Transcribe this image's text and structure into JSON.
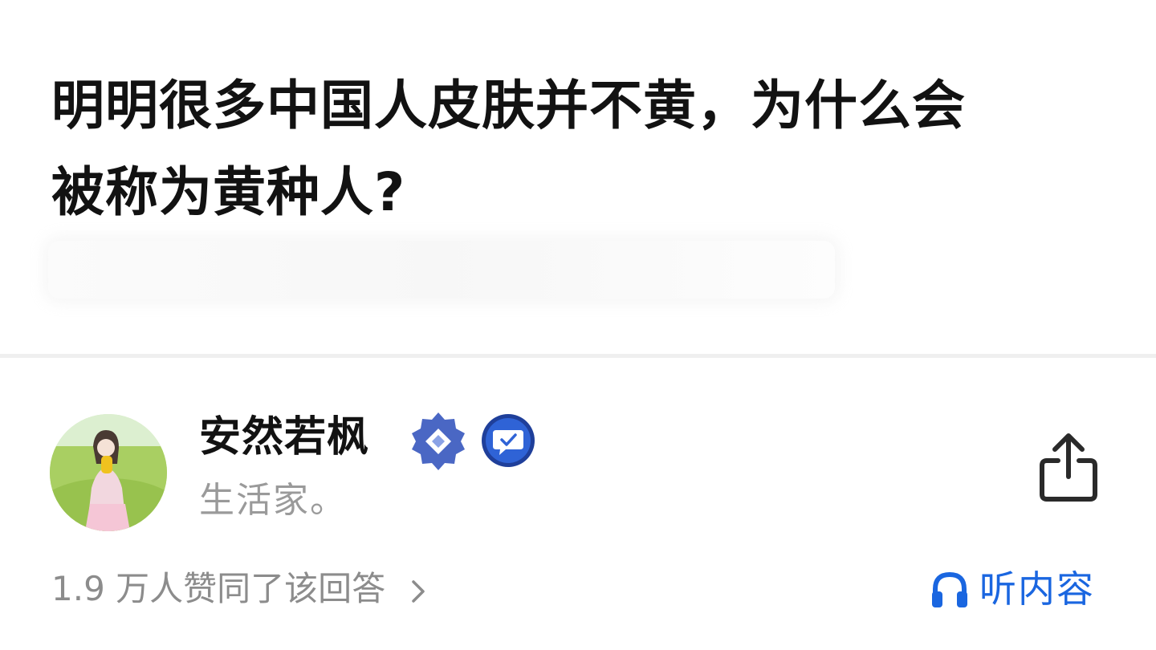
{
  "question": {
    "title_line1": "明明很多中国人皮肤并不黄，为什么会",
    "title_line2": "被称为黄种人?"
  },
  "author": {
    "name": "安然若枫",
    "bio": "生活家。",
    "avatar_icon": "avatar-photo",
    "badges": [
      "diamond-badge-icon",
      "message-badge-icon"
    ]
  },
  "actions": {
    "share_icon": "share-icon",
    "listen_icon": "headphones-icon",
    "listen_label": "听内容"
  },
  "stats": {
    "votes_text": "1.9 万人赞同了该回答"
  },
  "colors": {
    "title": "#121212",
    "muted": "#8c8c8c",
    "accent": "#1a66e0",
    "badge": "#4a67c4",
    "divider": "#efefef"
  }
}
